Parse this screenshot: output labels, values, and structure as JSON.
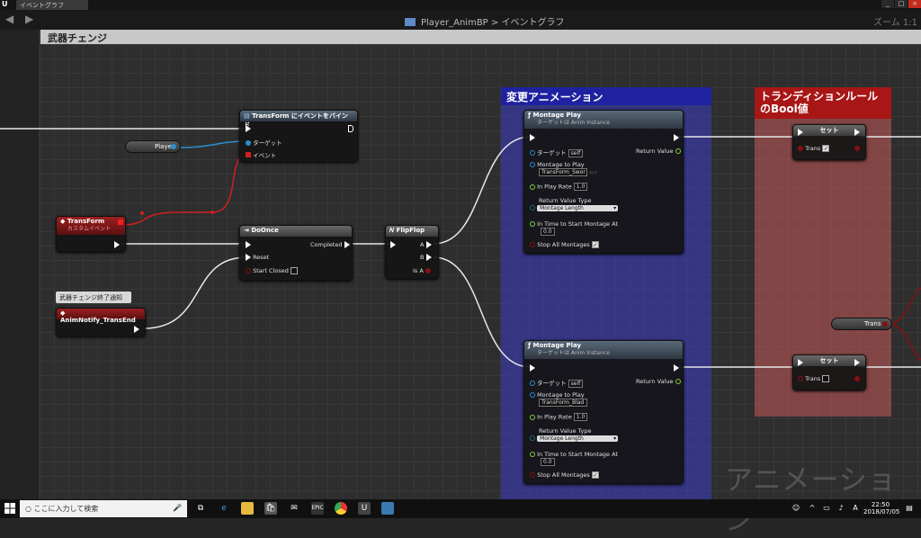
{
  "window": {
    "tab": "イベントグラフ"
  },
  "nav": {
    "bp": "Player_AnimBP",
    "sep": ">",
    "graph": "イベントグラフ",
    "zoom": "ズーム 1:1"
  },
  "comments": {
    "weapon": "武器チェンジ",
    "anim": "変更アニメーション",
    "trans_line1": "トランディションルール",
    "trans_line2": "のBool値"
  },
  "nodes": {
    "bind": {
      "title": "TransForm にイベントをバインド",
      "target": "ターゲット",
      "event": "イベント"
    },
    "player": {
      "label": "Player"
    },
    "transform_event": {
      "title": "TransForm",
      "sub": "カスタムイベント"
    },
    "comment_bubble": "武器チェンジ終了通知",
    "notify": {
      "title": "AnimNotify_TransEnd"
    },
    "doonce": {
      "title": "DoOnce",
      "completed": "Completed",
      "reset": "Reset",
      "start_closed": "Start Closed"
    },
    "flipflop": {
      "title": "FlipFlop",
      "a": "A",
      "b": "B",
      "isa": "Is A"
    },
    "montage1": {
      "title": "Montage Play",
      "sub": "ターゲットは Anim Instance",
      "target": "ターゲット",
      "self": "self",
      "montage": "Montage to Play",
      "montage_val": "TransForm_Swor",
      "rate": "In Play Rate",
      "rate_val": "1.0",
      "rvt": "Return Value Type",
      "rvt_val": "Montage Length",
      "time": "In Time to Start Montage At",
      "time_val": "0.0",
      "stop": "Stop All Montages",
      "ret": "Return Value"
    },
    "montage2": {
      "title": "Montage Play",
      "sub": "ターゲットは Anim Instance",
      "target": "ターゲット",
      "self": "self",
      "montage": "Montage to Play",
      "montage_val": "TransForm_Blad",
      "rate": "In Play Rate",
      "rate_val": "1.0",
      "rvt": "Return Value Type",
      "rvt_val": "Montage Length",
      "time": "In Time to Start Montage At",
      "time_val": "0.0",
      "stop": "Stop All Montages",
      "ret": "Return Value"
    },
    "set1": {
      "title": "セット",
      "var": "Trans"
    },
    "set2": {
      "title": "セット",
      "var": "Trans"
    },
    "trans_getter": {
      "label": "Trans"
    }
  },
  "watermark": "アニメーション",
  "taskbar": {
    "search": "ここに入力して検索",
    "time": "22:50",
    "date": "2018/07/05"
  },
  "colors": {
    "anim_comment": "#1e22a0",
    "trans_comment": "#a81616",
    "exec_wire": "#e8e8e8",
    "red_wire": "#d02020",
    "blue_wire": "#2a90d0"
  }
}
